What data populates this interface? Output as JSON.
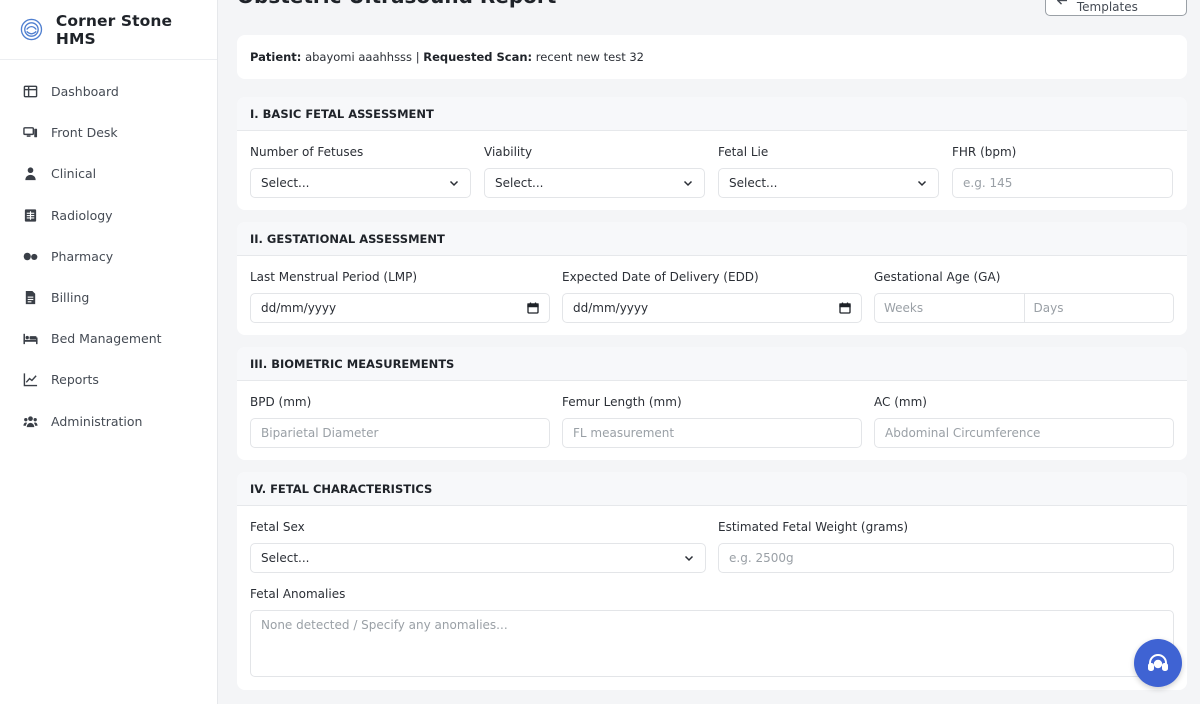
{
  "app": {
    "name": "Corner Stone HMS"
  },
  "sidebar": {
    "items": [
      {
        "label": "Dashboard",
        "icon": "dashboard-icon"
      },
      {
        "label": "Front Desk",
        "icon": "desk-monitor-icon"
      },
      {
        "label": "Clinical",
        "icon": "user-doctor-icon"
      },
      {
        "label": "Radiology",
        "icon": "x-ray-icon"
      },
      {
        "label": "Pharmacy",
        "icon": "pills-icon"
      },
      {
        "label": "Billing",
        "icon": "invoice-icon"
      },
      {
        "label": "Bed Management",
        "icon": "bed-icon"
      },
      {
        "label": "Reports",
        "icon": "line-chart-icon"
      },
      {
        "label": "Administration",
        "icon": "users-icon"
      }
    ]
  },
  "header": {
    "title": "Obstetric Ultrasound Report",
    "back_label": "Back To Templates"
  },
  "patient": {
    "patient_label": "Patient:",
    "patient_name": "abayomi aaahhsss",
    "separator": "|",
    "scan_label": "Requested Scan:",
    "scan_name": "recent new test 32"
  },
  "sections": {
    "basic": {
      "title": "I. BASIC FETAL ASSESSMENT",
      "fields": {
        "fetuses": {
          "label": "Number of Fetuses",
          "value": "Select..."
        },
        "viability": {
          "label": "Viability",
          "value": "Select..."
        },
        "lie": {
          "label": "Fetal Lie",
          "value": "Select..."
        },
        "fhr": {
          "label": "FHR (bpm)",
          "placeholder": "e.g. 145"
        }
      }
    },
    "gestational": {
      "title": "II. GESTATIONAL ASSESSMENT",
      "fields": {
        "lmp": {
          "label": "Last Menstrual Period (LMP)",
          "value": "dd/mm/yyyy"
        },
        "edd": {
          "label": "Expected Date of Delivery (EDD)",
          "value": "dd/mm/yyyy"
        },
        "ga": {
          "label": "Gestational Age (GA)",
          "weeks_placeholder": "Weeks",
          "days_placeholder": "Days"
        }
      }
    },
    "biometric": {
      "title": "III. BIOMETRIC MEASUREMENTS",
      "fields": {
        "bpd": {
          "label": "BPD (mm)",
          "placeholder": "Biparietal Diameter"
        },
        "fl": {
          "label": "Femur Length (mm)",
          "placeholder": "FL measurement"
        },
        "ac": {
          "label": "AC (mm)",
          "placeholder": "Abdominal Circumference"
        }
      }
    },
    "characteristics": {
      "title": "IV. FETAL CHARACTERISTICS",
      "fields": {
        "sex": {
          "label": "Fetal Sex",
          "value": "Select..."
        },
        "efw": {
          "label": "Estimated Fetal Weight (grams)",
          "placeholder": "e.g. 2500g"
        },
        "anomalies": {
          "label": "Fetal Anomalies",
          "placeholder": "None detected / Specify any anomalies..."
        }
      }
    }
  },
  "colors": {
    "accent": "#3f63d3",
    "background": "#f4f5f7"
  }
}
